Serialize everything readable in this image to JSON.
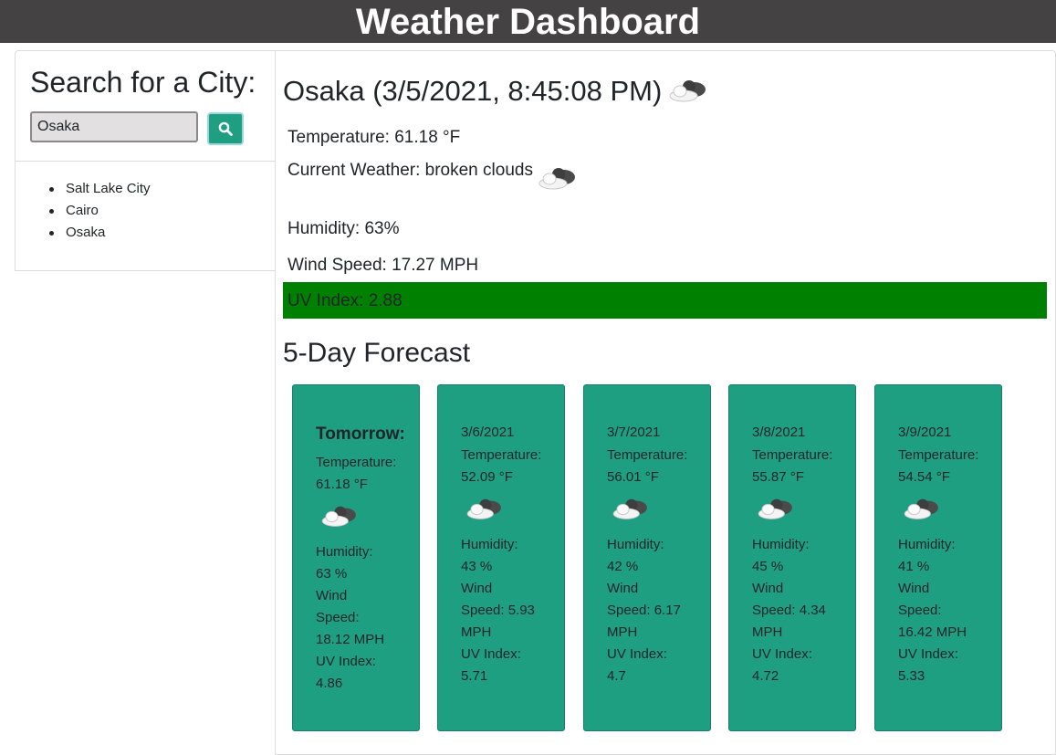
{
  "header": {
    "title": "Weather Dashboard"
  },
  "search": {
    "title": "Search for a City:",
    "input_value": "Osaka",
    "button_icon": "search-icon"
  },
  "history": {
    "items": [
      "Salt Lake City",
      "Cairo",
      "Osaka"
    ]
  },
  "current": {
    "title": "Osaka (3/5/2021, 8:45:08 PM)",
    "temperature": "Temperature: 61.18 °F",
    "weather": "Current Weather: broken clouds",
    "weather_icon": "broken-clouds-icon",
    "humidity": "Humidity: 63%",
    "wind": "Wind Speed: 17.27 MPH",
    "uv": "UV Index: 2.88",
    "uv_color": "#008000"
  },
  "forecast": {
    "title": "5-Day Forecast",
    "card_color": "#1e9f82",
    "days": [
      {
        "heading": "Tomorrow:",
        "temp_label": "Temperature:",
        "temp": "61.18 °F",
        "humidity_label": "Humidity:",
        "humidity": "63 %",
        "wind_label_1": "Wind",
        "wind_label_2": "Speed:",
        "wind": "18.12 MPH",
        "uv_label": "UV Index:",
        "uv": "4.86"
      },
      {
        "heading": "3/6/2021",
        "temp_label": "Temperature:",
        "temp": "52.09 °F",
        "humidity_label": "Humidity:",
        "humidity": "43 %",
        "wind_label_1": "Wind",
        "wind_label_2": "Speed: 5.93",
        "wind": "MPH",
        "uv_label": "UV Index:",
        "uv": "5.71"
      },
      {
        "heading": "3/7/2021",
        "temp_label": "Temperature:",
        "temp": "56.01 °F",
        "humidity_label": "Humidity:",
        "humidity": "42 %",
        "wind_label_1": "Wind",
        "wind_label_2": "Speed: 6.17",
        "wind": "MPH",
        "uv_label": "UV Index:",
        "uv": "4.7"
      },
      {
        "heading": "3/8/2021",
        "temp_label": "Temperature:",
        "temp": "55.87 °F",
        "humidity_label": "Humidity:",
        "humidity": "45 %",
        "wind_label_1": "Wind",
        "wind_label_2": "Speed: 4.34",
        "wind": "MPH",
        "uv_label": "UV Index:",
        "uv": "4.72"
      },
      {
        "heading": "3/9/2021",
        "temp_label": "Temperature:",
        "temp": "54.54 °F",
        "humidity_label": "Humidity:",
        "humidity": "41 %",
        "wind_label_1": "Wind",
        "wind_label_2": "Speed:",
        "wind": "16.42 MPH",
        "uv_label": "UV Index:",
        "uv": "5.33"
      }
    ]
  }
}
